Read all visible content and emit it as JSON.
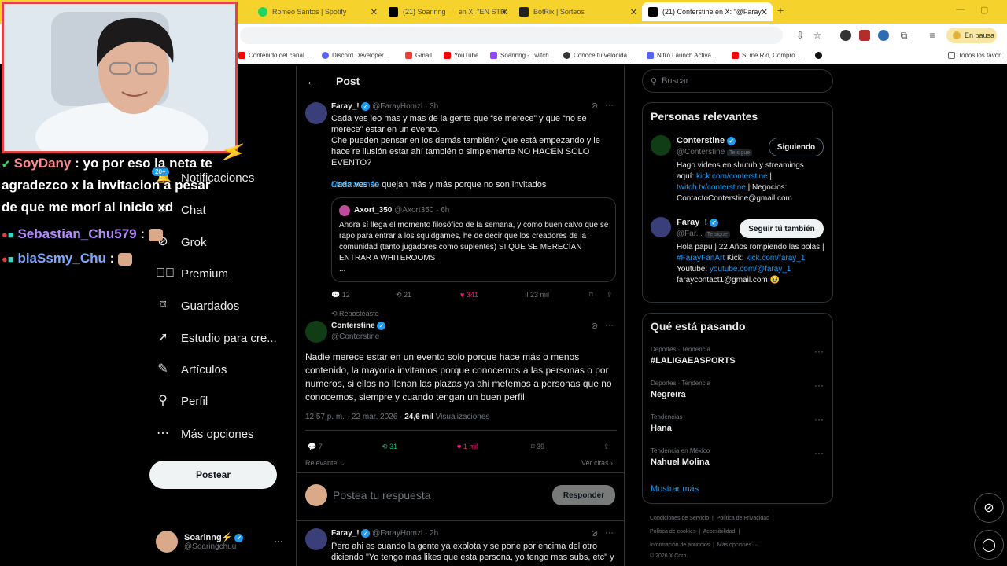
{
  "browser": {
    "tabs": [
      {
        "title": "Romeo Santos | Spotify",
        "icon": "spotify-icon",
        "color": "#1ed760"
      },
      {
        "title": "(21) Soarinng ⚡ en X: \"EN STR",
        "icon": "x-icon",
        "color": "#000000"
      },
      {
        "title": "BotRix | Sorteos",
        "icon": "botrix-icon",
        "color": "#222222"
      },
      {
        "title": "(21) Conterstine en X: \"@Faray",
        "icon": "x-icon",
        "color": "#000000"
      }
    ],
    "pause_label": "En pausa",
    "bookmarks": [
      {
        "label": "Contenido del canal...",
        "color": "#ff0000"
      },
      {
        "label": "Discord Developer...",
        "color": "#5865f2"
      },
      {
        "label": "Gmail",
        "color": "#ea4335"
      },
      {
        "label": "YouTube",
        "color": "#ff0000"
      },
      {
        "label": "Soarinng - Twitch",
        "color": "#9146ff"
      },
      {
        "label": "Conoce tu velocida...",
        "color": "#333333"
      },
      {
        "label": "Nitro Launch Activa...",
        "color": "#5865f2"
      },
      {
        "label": "Si me Rio, Compro...",
        "color": "#ff0000"
      }
    ],
    "bookmarks_folder": "Todos los favori"
  },
  "stream_overlay": {
    "chat": [
      {
        "user": "SoyDany",
        "user_color": "#ff8a8a",
        "text": " : yo por eso la neta te"
      },
      {
        "user": "",
        "user_color": "#ffffff",
        "text": "agradezco x la invitacion a pesar"
      },
      {
        "user": "",
        "user_color": "#ffffff",
        "text": "de que me morí al inicio xd"
      },
      {
        "user": "Sebastian_Chu579",
        "user_color": "#b58cff",
        "text": " : "
      },
      {
        "user": "biaSsmy_Chu",
        "user_color": "#7fa8ff",
        "text": " : "
      }
    ]
  },
  "sidebar": {
    "items": [
      {
        "label": "Notificaciones",
        "icon": "bell-icon",
        "badge": "20+"
      },
      {
        "label": "Chat",
        "icon": "mail-icon"
      },
      {
        "label": "Grok",
        "icon": "grok-icon"
      },
      {
        "label": "Premium",
        "icon": "premium-icon"
      },
      {
        "label": "Guardados",
        "icon": "bookmark-icon"
      },
      {
        "label": "Estudio para cre...",
        "icon": "rocket-icon"
      },
      {
        "label": "Artículos",
        "icon": "article-icon"
      },
      {
        "label": "Perfil",
        "icon": "person-icon"
      },
      {
        "label": "Más opciones",
        "icon": "more-icon"
      }
    ],
    "post_button": "Postear",
    "account": {
      "name": "Soarinng⚡",
      "handle": "@Soaringchuu"
    }
  },
  "main": {
    "title": "Post",
    "parent_tweet": {
      "name": "Faray_!",
      "handle": "@FarayHomzl",
      "time": "· 3h",
      "text": "Cada ves leo mas y mas de la gente que “se merece” y que “no se merece” estar en un evento.\nChe pueden pensar en los demás también? Que está empezando y le hace re ilusión estar ahí también o simplemente NO HACEN SOLO EVENTO?\n\nCada ves se quejan más y más porque no son invitados",
      "show_more": "Mostrar más",
      "quote": {
        "name": "Axort_350",
        "handle": "@Axort350",
        "time": "· 6h",
        "text": "Ahora sí llega el momento filosófico de la semana, y como buen calvo que se rapo para entrar a los squidgames, he de decir que los creadores de la comunidad (tanto jugadores como suplentes) SI QUE SE MERECÍAN ENTRAR A WHITEROOMS\n..."
      },
      "stats": {
        "replies": "12",
        "reposts": "21",
        "likes": "341",
        "views": "23 mil"
      }
    },
    "repost_label": "Reposteaste",
    "focus_tweet": {
      "name": "Conterstine",
      "handle": "@Conterstine",
      "text": "Nadie merece estar en un evento solo porque hace más o menos contenido, la mayoria invitamos porque conocemos a las personas o por numeros, si ellos no llenan las plazas ya ahi metemos a personas que no conocemos, siempre y cuando tengan un buen perfil",
      "timestamp": "12:57 p. m. · 22 mar. 2026 · ",
      "views_value": "24,6 mil",
      "views_label": " Visualizaciones",
      "stats": {
        "replies": "7",
        "reposts": "31",
        "likes": "1 mil",
        "bookmarks": "39"
      },
      "sort_label": "Relevante",
      "quotes_link": "Ver citas"
    },
    "reply_placeholder": "Postea tu respuesta",
    "reply_button": "Responder",
    "reply_tweet": {
      "name": "Faray_!",
      "handle": "@FarayHomzl",
      "time": "· 2h",
      "text": "Pero ahi es cuando la gente ya explota y se pone por encima del otro diciendo \"Yo tengo mas likes que esta persona, yo tengo mas subs, etc\" y"
    }
  },
  "right": {
    "search_placeholder": "Buscar",
    "relevant": {
      "title": "Personas relevantes",
      "people": [
        {
          "name": "Conterstine",
          "handle": "@Conterstine",
          "follows_you": "Te sigue",
          "button": "Siguiendo",
          "bio_parts": [
            "Hago videos en shutub y streamings aquí: ",
            "kick.com/conterstine",
            " | ",
            "twitch.tv/conterstine",
            " | Negocios: ContactoConterstine@gmail.com"
          ]
        },
        {
          "name": "Faray_!",
          "handle": "@Far...",
          "follows_you": "Te sigue",
          "button": "Seguir tú también",
          "bio_parts": [
            "Hola papu | 22 Años rompiendo las bolas | ",
            "#FarayFanArt",
            " Kick: ",
            "kick.com/faray_1",
            " Youtube: ",
            "youtube.com/@faray_1",
            " faraycontact1@gmail.com 🥹"
          ]
        }
      ]
    },
    "trending": {
      "title": "Qué está pasando",
      "items": [
        {
          "context": "Deportes · Tendencia",
          "topic": "#LALIGAEASPORTS"
        },
        {
          "context": "Deportes · Tendencia",
          "topic": "Negreira"
        },
        {
          "context": "Tendencias",
          "topic": "Hana"
        },
        {
          "context": "Tendencia en México",
          "topic": "Nahuel Molina"
        }
      ],
      "show_more": "Mostrar más"
    },
    "footer": [
      [
        "Condiciones de Servicio",
        "Política de Privacidad"
      ],
      [
        "Política de cookies",
        "Accesibilidad"
      ],
      [
        "Información de anuncios",
        "Más opciones ···"
      ],
      [
        "© 2026 X Corp."
      ]
    ]
  },
  "colors": {
    "accent": "#1d9bf0",
    "like": "#f91880",
    "repost": "#00ba7c",
    "tabbar": "#f6d22c"
  }
}
